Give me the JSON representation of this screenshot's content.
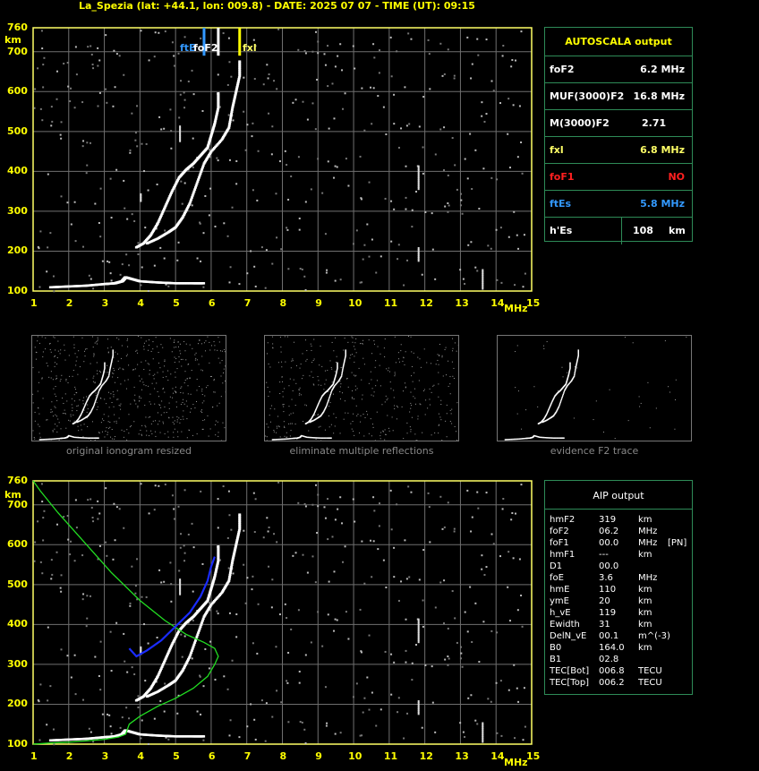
{
  "title": "La_Spezia (lat: +44.1, lon: 009.8) - DATE: 2025 07 07 - TIME (UT): 09:15",
  "axis": {
    "x_unit": "MHz",
    "y_unit": "km",
    "x_ticks": [
      "1",
      "2",
      "3",
      "4",
      "5",
      "6",
      "7",
      "8",
      "9",
      "10",
      "11",
      "12",
      "13",
      "14",
      "15"
    ],
    "y_ticks": [
      "100",
      "200",
      "300",
      "400",
      "500",
      "600",
      "700",
      "760"
    ]
  },
  "markers": {
    "ftE": "ftE",
    "foF2": "foF2",
    "fxl": "fxl"
  },
  "autoscala": {
    "header": "AUTOSCALA output",
    "rows": [
      {
        "label": "foF2",
        "value": "6.2 MHz",
        "color": "#ffffff"
      },
      {
        "label": "MUF(3000)F2",
        "value": "16.8 MHz",
        "color": "#ffffff"
      },
      {
        "label": "M(3000)F2",
        "value": "2.71",
        "color": "#ffffff"
      },
      {
        "label": "fxl",
        "value": "6.8 MHz",
        "color": "#ffff66"
      },
      {
        "label": "foF1",
        "value": "NO",
        "color": "#ff2020"
      },
      {
        "label": "ftEs",
        "value": "5.8 MHz",
        "color": "#3399ff"
      },
      {
        "label": "h'Es",
        "value": "108",
        "unit": "km",
        "color": "#ffffff"
      }
    ]
  },
  "thumbnails": [
    {
      "caption": "original ionogram resized"
    },
    {
      "caption": "eliminate multiple reflections"
    },
    {
      "caption": "evidence F2 trace"
    }
  ],
  "aip": {
    "header": "AIP output",
    "rows": [
      {
        "label": "hmF2",
        "value": "319",
        "unit": "km",
        "extra": ""
      },
      {
        "label": "foF2",
        "value": "06.2",
        "unit": "MHz",
        "extra": ""
      },
      {
        "label": "foF1",
        "value": "00.0",
        "unit": "MHz",
        "extra": "[PN]"
      },
      {
        "label": "hmF1",
        "value": "---",
        "unit": "km",
        "extra": ""
      },
      {
        "label": "D1",
        "value": "00.0",
        "unit": "",
        "extra": ""
      },
      {
        "label": "foE",
        "value": "3.6",
        "unit": "MHz",
        "extra": ""
      },
      {
        "label": "hmE",
        "value": "110",
        "unit": "km",
        "extra": ""
      },
      {
        "label": "ymE",
        "value": "20",
        "unit": "km",
        "extra": ""
      },
      {
        "label": "h_vE",
        "value": "119",
        "unit": "km",
        "extra": ""
      },
      {
        "label": "Ewidth",
        "value": "31",
        "unit": "km",
        "extra": ""
      },
      {
        "label": "DelN_vE",
        "value": "00.1",
        "unit": "m^(-3)",
        "extra": ""
      },
      {
        "label": "B0",
        "value": "164.0",
        "unit": "km",
        "extra": ""
      },
      {
        "label": "B1",
        "value": "02.8",
        "unit": "",
        "extra": ""
      },
      {
        "label": "TEC[Bot]",
        "value": "006.8",
        "unit": "TECU",
        "extra": ""
      },
      {
        "label": "TEC[Top]",
        "value": "006.2",
        "unit": "TECU",
        "extra": ""
      }
    ]
  },
  "chart_data": [
    {
      "type": "scatter",
      "name": "autoscala ionogram",
      "xlim": [
        1,
        15
      ],
      "ylim": [
        100,
        760
      ],
      "grid": true,
      "markers_mhz": {
        "ftE": 5.8,
        "foF2": 6.2,
        "fxl": 6.8
      },
      "e_trace": {
        "x": [
          1.5,
          2.0,
          2.5,
          3.0,
          3.3,
          3.5,
          3.6,
          4.0,
          4.5,
          5.0,
          5.5,
          5.8
        ],
        "y": [
          110,
          112,
          114,
          118,
          120,
          125,
          135,
          125,
          122,
          120,
          120,
          120
        ]
      },
      "o_trace": {
        "x": [
          3.9,
          4.1,
          4.3,
          4.5,
          4.7,
          4.9,
          5.1,
          5.3,
          5.5,
          5.7,
          5.9,
          6.0,
          6.1,
          6.2,
          6.2
        ],
        "y": [
          210,
          220,
          240,
          270,
          310,
          350,
          385,
          405,
          420,
          440,
          460,
          490,
          520,
          560,
          600
        ]
      },
      "x_trace": {
        "x": [
          4.2,
          4.5,
          4.8,
          5.0,
          5.2,
          5.4,
          5.6,
          5.8,
          6.0,
          6.3,
          6.5,
          6.6,
          6.7,
          6.8,
          6.8
        ],
        "y": [
          220,
          232,
          248,
          260,
          285,
          320,
          370,
          420,
          450,
          480,
          510,
          560,
          600,
          640,
          680
        ]
      }
    },
    {
      "type": "line",
      "name": "aip ionogram",
      "xlim": [
        1,
        15
      ],
      "ylim": [
        100,
        760
      ],
      "grid": true,
      "profile": {
        "x": [
          1.0,
          1.5,
          2.0,
          2.5,
          3.0,
          3.4,
          3.6,
          3.7,
          4.0,
          4.5,
          5.0,
          5.5,
          5.9,
          6.1,
          6.2,
          6.1,
          5.8,
          5.3,
          4.7,
          4.0,
          3.2,
          2.4,
          1.7,
          1.2,
          1.0
        ],
        "y": [
          100,
          103,
          105,
          108,
          112,
          118,
          125,
          150,
          170,
          195,
          215,
          240,
          270,
          300,
          320,
          340,
          355,
          375,
          410,
          460,
          530,
          610,
          680,
          735,
          760
        ]
      },
      "fit": {
        "x": [
          3.7,
          3.9,
          4.2,
          4.6,
          5.0,
          5.4,
          5.7,
          5.9,
          6.0,
          6.1
        ],
        "y": [
          340,
          320,
          335,
          360,
          395,
          430,
          470,
          510,
          545,
          570
        ]
      }
    }
  ]
}
